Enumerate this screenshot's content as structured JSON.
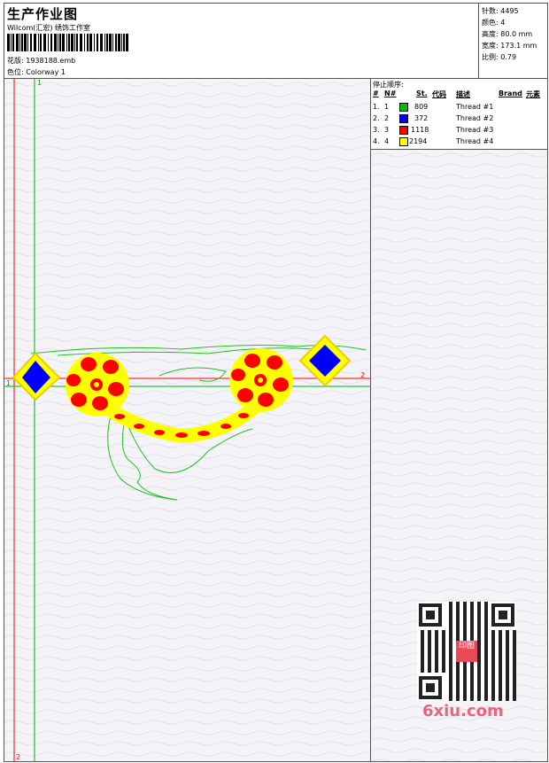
{
  "header": {
    "title": "生产作业图",
    "studio": "Wilcom(汇宏) 绣饰工作室",
    "design_label": "花版:",
    "design_file": "1938188.emb",
    "colorway_label": "色位:",
    "colorway": "Colorway 1"
  },
  "stats": [
    {
      "label": "针数:",
      "value": "4495"
    },
    {
      "label": "颜色:",
      "value": "4"
    },
    {
      "label": "高度:",
      "value": "80.0 mm"
    },
    {
      "label": "宽度:",
      "value": "173.1 mm"
    },
    {
      "label": "比例:",
      "value": "0.79"
    }
  ],
  "stop_sequence": {
    "title": "停止顺序:",
    "headers": {
      "hash": "#",
      "n": "N#",
      "st": "St.",
      "code": "代码",
      "desc": "描述",
      "brand": "Brand",
      "element": "元素"
    },
    "rows": [
      {
        "num": "1.",
        "n": "1",
        "color": "#00c000",
        "stitches": "809",
        "desc": "Thread #1"
      },
      {
        "num": "2.",
        "n": "2",
        "color": "#0000ff",
        "stitches": "372",
        "desc": "Thread #2"
      },
      {
        "num": "3.",
        "n": "3",
        "color": "#ff0000",
        "stitches": "1118",
        "desc": "Thread #3"
      },
      {
        "num": "4.",
        "n": "4",
        "color": "#ffff00",
        "stitches": "2194",
        "desc": "Thread #4"
      }
    ]
  },
  "axes": {
    "top_marker": "1",
    "right_marker": "2",
    "left_marker": "1",
    "bottom_marker": "2"
  },
  "watermark": {
    "site": "6xiu.com",
    "seal_text": "印图"
  }
}
